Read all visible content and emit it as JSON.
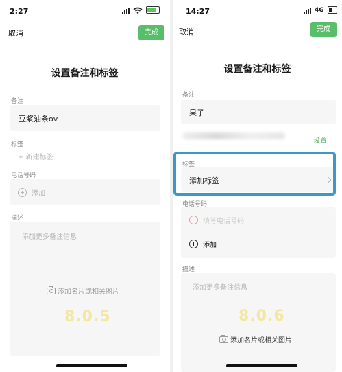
{
  "left": {
    "status_time": "2:27",
    "cancel": "取消",
    "done": "完成",
    "title": "设置备注和标签",
    "remark_label": "备注",
    "remark_value": "豆浆油条ov",
    "tag_label": "标签",
    "tag_hint": "+ 新建标签",
    "phone_label": "电话号码",
    "phone_add": "添加",
    "desc_label": "描述",
    "desc_placeholder": "添加更多备注信息",
    "add_image": "添加名片或相关图片",
    "version": "8.0.5"
  },
  "right": {
    "status_time": "14:27",
    "network": "4G",
    "cancel": "取消",
    "done": "完成",
    "title": "设置备注和标签",
    "remark_label": "备注",
    "remark_value": "果子",
    "settings_link": "设置",
    "tag_label": "标签",
    "tag_add": "添加标签",
    "phone_label": "电话号码",
    "phone_placeholder": "填写电话号码",
    "phone_add": "添加",
    "desc_label": "描述",
    "desc_placeholder": "添加更多备注信息",
    "version": "8.0.6",
    "add_image": "添加名片或相关图片"
  },
  "colors": {
    "accent_green": "#58be6a",
    "highlight_blue": "#3a99c6",
    "version_yellow": "#f4e7a4",
    "battery_charging": "#5ac85a",
    "battery_normal": "#222222"
  },
  "icons": {
    "signal": "signal-icon",
    "wifi": "wifi-icon",
    "battery": "battery-icon",
    "add": "plus-circle-icon",
    "remove": "minus-circle-icon",
    "camera": "camera-icon",
    "chevron": "chevron-right-icon"
  }
}
